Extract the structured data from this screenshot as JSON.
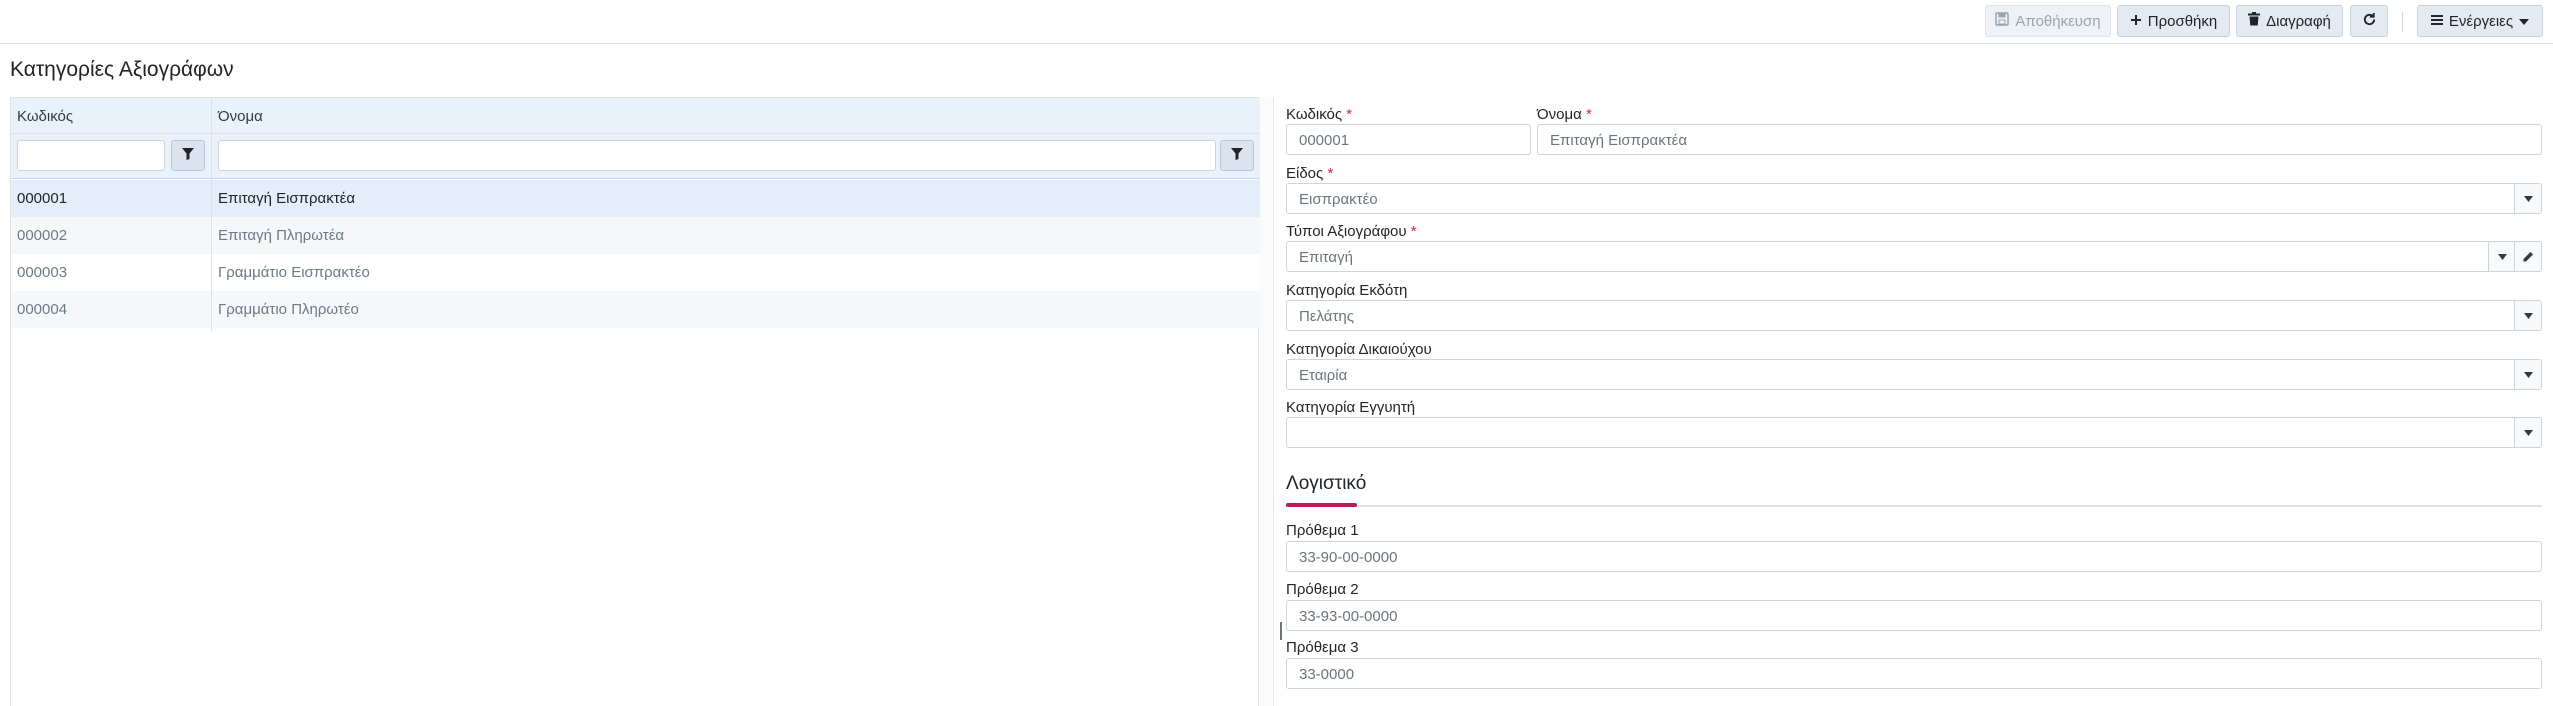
{
  "toolbar": {
    "save_label": "Αποθήκευση",
    "add_label": "Προσθήκη",
    "delete_label": "Διαγραφή",
    "actions_label": "Ενέργειες"
  },
  "page": {
    "title": "Κατηγορίες Αξιογράφων"
  },
  "grid": {
    "columns": [
      "Κωδικός",
      "Όνομα"
    ],
    "rows": [
      {
        "code": "000001",
        "name": "Επιταγή Εισπρακτέα",
        "selected": true
      },
      {
        "code": "000002",
        "name": "Επιταγή Πληρωτέα"
      },
      {
        "code": "000003",
        "name": "Γραμμάτιο Εισπρακτέο"
      },
      {
        "code": "000004",
        "name": "Γραμμάτιο Πληρωτέο"
      }
    ]
  },
  "form": {
    "code": {
      "label": "Κωδικός",
      "value": "000001"
    },
    "name": {
      "label": "Όνομα",
      "value": "Επιταγή Εισπρακτέα"
    },
    "kind": {
      "label": "Είδος",
      "value": "Εισπρακτέο"
    },
    "types": {
      "label": "Τύποι Αξιογράφου",
      "value": "Επιταγή"
    },
    "issuer_category": {
      "label": "Κατηγορία Εκδότη",
      "value": "Πελάτης"
    },
    "beneficiary_category": {
      "label": "Κατηγορία Δικαιούχου",
      "value": "Εταιρία"
    },
    "guarantor_category": {
      "label": "Κατηγορία Εγγυητή",
      "value": ""
    },
    "required_mark": "*"
  },
  "accounting": {
    "title": "Λογιστικό",
    "prefix1": {
      "label": "Πρόθεμα 1",
      "value": "33-90-00-0000"
    },
    "prefix2": {
      "label": "Πρόθεμα 2",
      "value": "33-93-00-0000"
    },
    "prefix3": {
      "label": "Πρόθεμα 3",
      "value": "33-0000"
    }
  },
  "colors": {
    "accent": "#c2185b",
    "selected_row": "#e3eefa",
    "header_bg": "#e9f2fb"
  }
}
